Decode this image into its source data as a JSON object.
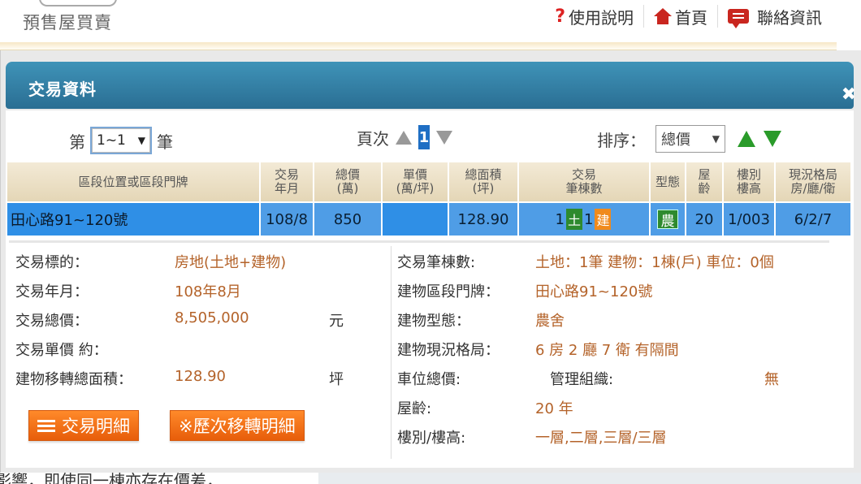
{
  "header": {
    "site_title": "預售屋買賣",
    "nav": [
      {
        "label": "使用說明",
        "icon": "help-icon"
      },
      {
        "label": "首頁",
        "icon": "home-icon"
      },
      {
        "label": "聯絡資訊",
        "icon": "chat-icon"
      }
    ]
  },
  "dialog": {
    "title": "交易資料",
    "close_glyph": "✖",
    "pagination": {
      "prefix": "第",
      "selected_range": "1~1",
      "suffix": "筆",
      "page_label": "頁次",
      "current_page": "1"
    },
    "sort": {
      "label": "排序：",
      "selected": "總價"
    },
    "table": {
      "columns": [
        {
          "line1": "區段位置或區段門牌",
          "line2": ""
        },
        {
          "line1": "交易",
          "line2": "年月"
        },
        {
          "line1": "總價",
          "line2": "(萬)"
        },
        {
          "line1": "單價",
          "line2": "(萬/坪)"
        },
        {
          "line1": "總面積",
          "line2": "(坪)"
        },
        {
          "line1": "交易",
          "line2": "筆棟數"
        },
        {
          "line1": "型態",
          "line2": ""
        },
        {
          "line1": "屋",
          "line2": "齡"
        },
        {
          "line1": "樓別",
          "line2": "樓高"
        },
        {
          "line1": "現況格局",
          "line2": "房/廳/衛"
        }
      ],
      "row": {
        "address": "田心路91~120號",
        "date": "108/8",
        "total_price": "850",
        "unit_price": "",
        "area": "128.90",
        "land_count": "1",
        "land_badge": "土",
        "bldg_count": "1",
        "bldg_badge": "建",
        "type_badge": "農",
        "age": "20",
        "floor": "1/003",
        "layout": "6/2/7"
      }
    },
    "detail": {
      "left": [
        {
          "label": "交易標的：",
          "value": "房地(土地+建物)",
          "unit": ""
        },
        {
          "label": "交易年月：",
          "value": "108年8月",
          "unit": ""
        },
        {
          "label": "交易總價：",
          "value": "8,505,000",
          "unit": "元"
        },
        {
          "label": "交易單價 約：",
          "value": "",
          "unit": ""
        },
        {
          "label": "建物移轉總面積：",
          "value": "128.90",
          "unit": "坪"
        }
      ],
      "right": [
        {
          "label": "交易筆棟數:",
          "value": "土地：1筆 建物：1棟(戶) 車位：0個"
        },
        {
          "label": "建物區段門牌：",
          "value": "田心路91~120號"
        },
        {
          "label": "建物型態：",
          "value": "農舍"
        },
        {
          "label": "建物現況格局：",
          "value": "6 房 2 廳 7 衛 有隔間"
        },
        {
          "label": "車位總價:",
          "value": ""
        },
        {
          "label": "屋齡:",
          "value": "20 年"
        },
        {
          "label": "樓別/樓高:",
          "value": "一層,二層,三層/三層"
        }
      ],
      "mgmt_label": "管理組織:",
      "mgmt_value": "無",
      "buttons": {
        "detail": "交易明細",
        "history": "※歷次移轉明細"
      }
    }
  },
  "bottom": {
    "text": "影響，即使同一棟亦存在價差，"
  },
  "colors": {
    "header_blue": "#2a6e93",
    "row_blue": "#2f8fe6",
    "value_brown": "#b4632a",
    "button_orange": "#e75d0a",
    "sort_green": "#2a9b2a"
  }
}
